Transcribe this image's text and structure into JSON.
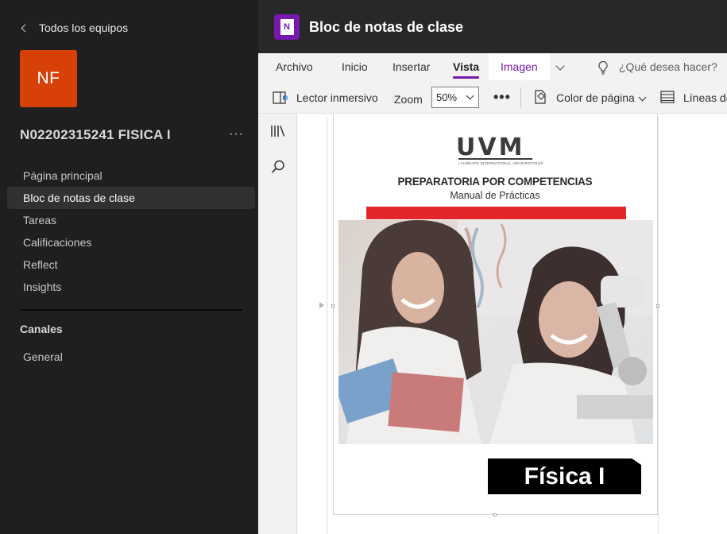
{
  "sidebar": {
    "back_label": "Todos los equipos",
    "team_initials": "NF",
    "team_name": "N02202315241 FISICA I",
    "more_label": "···",
    "nav_items": [
      {
        "label": "Página principal"
      },
      {
        "label": "Bloc de notas de clase",
        "active": true
      },
      {
        "label": "Tareas"
      },
      {
        "label": "Calificaciones"
      },
      {
        "label": "Reflect"
      },
      {
        "label": "Insights"
      }
    ],
    "channels_heading": "Canales",
    "channels": [
      {
        "label": "General"
      }
    ]
  },
  "header": {
    "title": "Bloc de notas de clase",
    "app_icon": "onenote-icon",
    "app_icon_letter": "N"
  },
  "ribbon": {
    "tabs": [
      {
        "label": "Archivo"
      },
      {
        "label": "Inicio"
      },
      {
        "label": "Insertar"
      },
      {
        "label": "Vista",
        "selected": true
      },
      {
        "label": "Imagen",
        "contextual": true
      }
    ],
    "tell_me_placeholder": "¿Qué desea hacer?",
    "tools": {
      "immersive_reader": "Lector inmersivo",
      "zoom_label": "Zoom",
      "zoom_value": "50%",
      "more": "•••",
      "page_color": "Color de página",
      "rule_lines": "Líneas de"
    }
  },
  "page": {
    "logo_text": "UVM",
    "logo_subtext": "LAUREATE INTERNATIONAL UNIVERSITIES®",
    "heading": "PREPARATORIA POR COMPETENCIAS",
    "subheading": "Manual de Prácticas",
    "cover_title": "Física I",
    "accent_color": "#e3262c"
  },
  "colors": {
    "brand": "#7719aa",
    "team_avatar": "#d74108",
    "sidebar_bg": "#201f1f"
  }
}
